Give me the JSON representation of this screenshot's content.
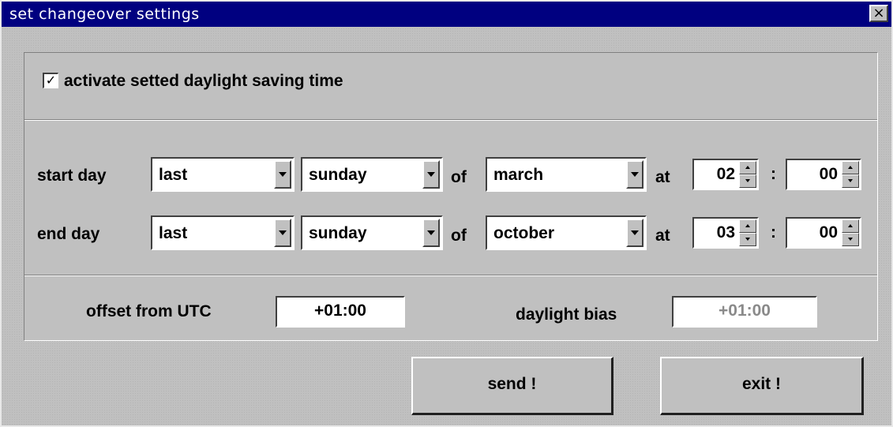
{
  "window": {
    "title": "set changeover settings",
    "close_glyph": "×"
  },
  "dst": {
    "checkbox_checked": true,
    "checkbox_mark": "✓",
    "label": "activate setted daylight saving time"
  },
  "start": {
    "label": "start day",
    "ordinal": "last",
    "weekday": "sunday",
    "of": "of",
    "month": "march",
    "at": "at",
    "hour": "02",
    "minute": "00"
  },
  "end": {
    "label": "end day",
    "ordinal": "last",
    "weekday": "sunday",
    "of": "of",
    "month": "october",
    "at": "at",
    "hour": "03",
    "minute": "00"
  },
  "time_separator": ":",
  "offset": {
    "label": "offset from UTC",
    "value": "+01:00"
  },
  "bias": {
    "label": "daylight bias",
    "value": "+01:00"
  },
  "buttons": {
    "send": "send !",
    "exit": "exit !"
  },
  "icons": [
    "close-icon",
    "check-icon",
    "dropdown-arrow-icon",
    "spin-up-icon",
    "spin-down-icon"
  ]
}
